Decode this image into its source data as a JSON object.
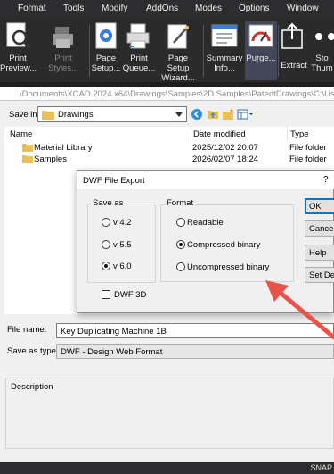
{
  "menubar": {
    "items": [
      "Format",
      "Tools",
      "Modify",
      "AddOns",
      "Modes",
      "Options",
      "Window"
    ]
  },
  "toolbar": {
    "print_preview": [
      "Print",
      "Preview..."
    ],
    "print_styles": [
      "Print Styles..."
    ],
    "page_setup": [
      "Page",
      "Setup..."
    ],
    "print_queue": [
      "Print",
      "Queue..."
    ],
    "page_setup_wizard": [
      "Page Setup",
      "Wizard..."
    ],
    "summary_info": [
      "Summary",
      "Info..."
    ],
    "purge": [
      "Purge..."
    ],
    "extract": [
      "Extract"
    ],
    "more": [
      "Sto",
      "Thum"
    ]
  },
  "save_dialog": {
    "path": "\\Documents\\XCAD 2024 x64\\Drawings\\Samples\\2D Samples\\PatentDrawings\\C:\\Users\\",
    "save_in_label": "Save in:",
    "save_in_value": "Drawings",
    "columns": {
      "name": "Name",
      "date": "Date modified",
      "type": "Type"
    },
    "files": [
      {
        "name": "Material Library",
        "date": "2025/12/02 20:07",
        "type": "File folder"
      },
      {
        "name": "Samples",
        "date": "2026/02/07 18:24",
        "type": "File folder"
      }
    ],
    "file_name_label": "File name:",
    "file_name_value": "Key Duplicating Machine 1B",
    "save_as_type_label": "Save as type:",
    "save_as_type_value": "DWF - Design Web Format",
    "description_label": "Description"
  },
  "dwf_dialog": {
    "title": "DWF File Export",
    "help": "?",
    "save_as_label": "Save as",
    "versions": [
      {
        "label": "v 4.2",
        "selected": false
      },
      {
        "label": "v 5.5",
        "selected": false
      },
      {
        "label": "v 6.0",
        "selected": true
      }
    ],
    "dwf3d_label": "DWF 3D",
    "dwf3d_checked": false,
    "format_label": "Format",
    "formats": [
      {
        "label": "Readable",
        "selected": false
      },
      {
        "label": "Compressed binary",
        "selected": true
      },
      {
        "label": "Uncompressed binary",
        "selected": false
      }
    ],
    "buttons": [
      "OK",
      "Cancel",
      "Help",
      "Set Defaults"
    ]
  },
  "status": {
    "snap": "SNAP"
  },
  "colors": {
    "accent": "#0078d4",
    "arrow": "#e8534a",
    "folder": "#e8c05a",
    "dark_bg": "#2b2b2b"
  }
}
